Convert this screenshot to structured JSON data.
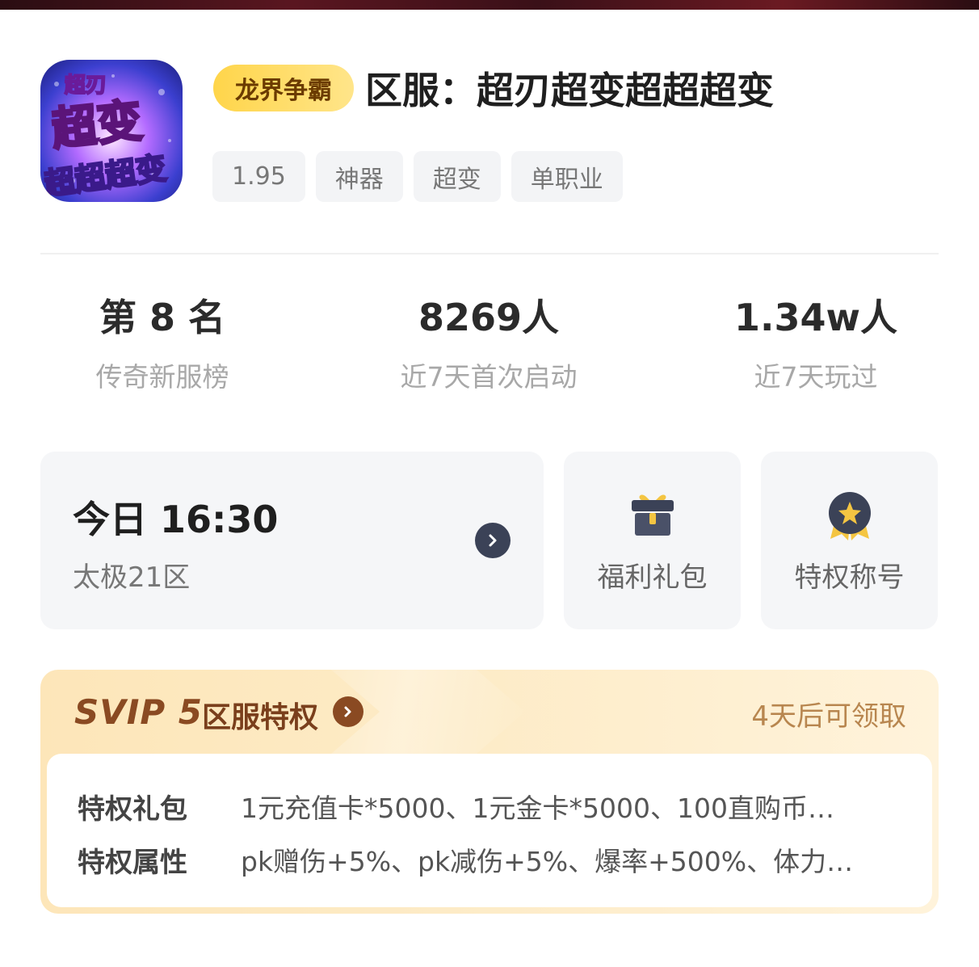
{
  "game": {
    "icon_name": "game-app-icon",
    "icon_text_top": "超刃",
    "icon_text_mid": "超变",
    "icon_text_bottom": "超超超变",
    "server_badge": "龙界争霸",
    "title": "区服：超刃超变超超超变",
    "tags": [
      "1.95",
      "神器",
      "超变",
      "单职业"
    ]
  },
  "stats": [
    {
      "value": "第 8 名",
      "label": "传奇新服榜"
    },
    {
      "value": "8269人",
      "label": "近7天首次启动"
    },
    {
      "value": "1.34w人",
      "label": "近7天玩过"
    }
  ],
  "open_server": {
    "time": "今日 16:30",
    "zone": "太极21区",
    "icon": "chevron-right-icon"
  },
  "actions": {
    "gift": {
      "label": "福利礼包",
      "icon": "gift-box-icon"
    },
    "title": {
      "label": "特权称号",
      "icon": "star-medal-icon"
    }
  },
  "svip": {
    "level": "SVIP 5",
    "title": "区服特权",
    "status": "4天后可领取",
    "rows": [
      {
        "label": "特权礼包",
        "value": "1元充值卡*5000、1元金卡*5000、100直购币…"
      },
      {
        "label": "特权属性",
        "value": "pk赠伤+5%、pk减伤+5%、爆率+500%、体力…"
      }
    ]
  },
  "colors": {
    "badge": "#ffd54a",
    "svip_text": "#8a4a22",
    "svip_bg": "#fde6b9",
    "card_bg": "#f5f6f8"
  }
}
